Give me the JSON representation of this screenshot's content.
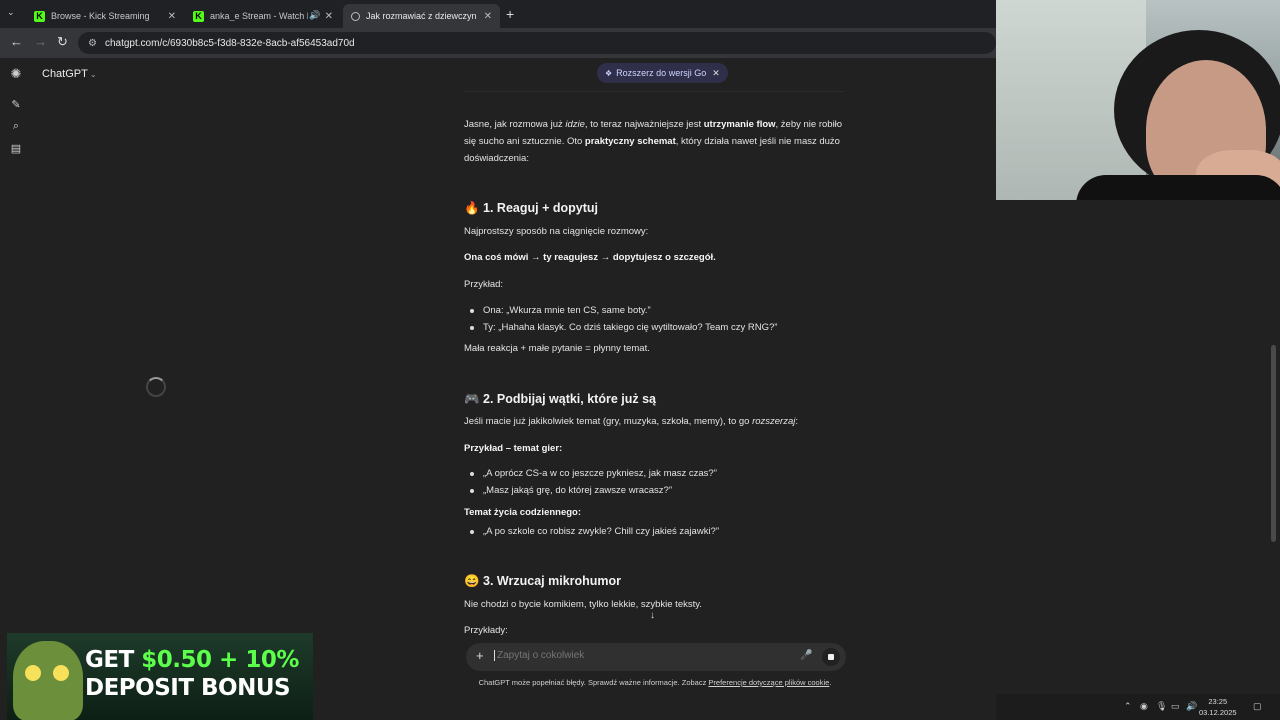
{
  "browser": {
    "tabs": [
      {
        "title": "Browse - Kick Streaming",
        "icon": "kick-icon"
      },
      {
        "title": "anka_e Stream - Watch Live",
        "icon": "kick-icon"
      },
      {
        "title": "Jak rozmawiać z dziewczyną ga",
        "icon": "chatgpt-icon"
      }
    ],
    "url": "chatgpt.com/c/6930b8c5-f3d8-832e-8acb-af56453ad70d"
  },
  "app": {
    "brand": "ChatGPT",
    "upgrade_pill": "Rozszerz do wersji Go"
  },
  "message": {
    "intro_1": "Jasne, jak rozmowa już ",
    "intro_idzie": "idzie",
    "intro_2": ", to teraz najważniejsze jest ",
    "intro_flow": "utrzymanie flow",
    "intro_3": ", żeby nie robiło się sucho ani sztucznie. Oto ",
    "intro_schemat": "praktyczny schemat",
    "intro_4": ", który działa nawet jeśli nie masz dużo doświadczenia:",
    "s1_title": "🔥 1. Reaguj + dopytuj",
    "s1_p1": "Najprostszy sposób na ciągnięcie rozmowy:",
    "s1_p2": "Ona coś mówi → ty reagujesz → dopytujesz o szczegół.",
    "s1_p3": "Przykład:",
    "s1_li": [
      "Ona: „Wkurza mnie ten CS, same boty.”",
      "Ty: „Hahaha klasyk. Co dziś takiego cię wytiltowało? Team czy RNG?”"
    ],
    "s1_p4": "Mała reakcja + małe pytanie = płynny temat.",
    "s2_title": "🎮 2. Podbijaj wątki, które już są",
    "s2_p1a": "Jeśli macie już jakikolwiek temat (gry, muzyka, szkoła, memy), to go ",
    "s2_p1b": "rozszerzaj",
    "s2_p1c": ":",
    "s2_p2": "Przykład – temat gier:",
    "s2_li": [
      "„A oprócz CS-a w co jeszcze pykniesz, jak masz czas?”",
      "„Masz jakąś grę, do której zawsze wracasz?”"
    ],
    "s2_p3": "Temat życia codziennego:",
    "s2_li2": [
      "„A po szkole co robisz zwykle? Chill czy jakieś zajawki?”"
    ],
    "s3_title": "😄 3. Wrzucaj mikrohumor",
    "s3_p1": "Nie chodzi o bycie komikiem, tylko lekkie, szybkie teksty.",
    "s3_p2": "Przykłady:"
  },
  "composer": {
    "placeholder": "Zapytaj o cokolwiek",
    "disclaimer": "ChatGPT może popełniać błędy. Sprawdź ważne informacje. Zobacz ",
    "disclaimer_link": "Preferencje dotyczące plików cookie",
    "disclaimer_end": "."
  },
  "ad": {
    "line1_a": "GET ",
    "line1_b": "$0.50 + 10%",
    "line2": "DEPOSIT BONUS"
  },
  "taskbar": {
    "time": "23:25",
    "date": "03.12.2025"
  }
}
